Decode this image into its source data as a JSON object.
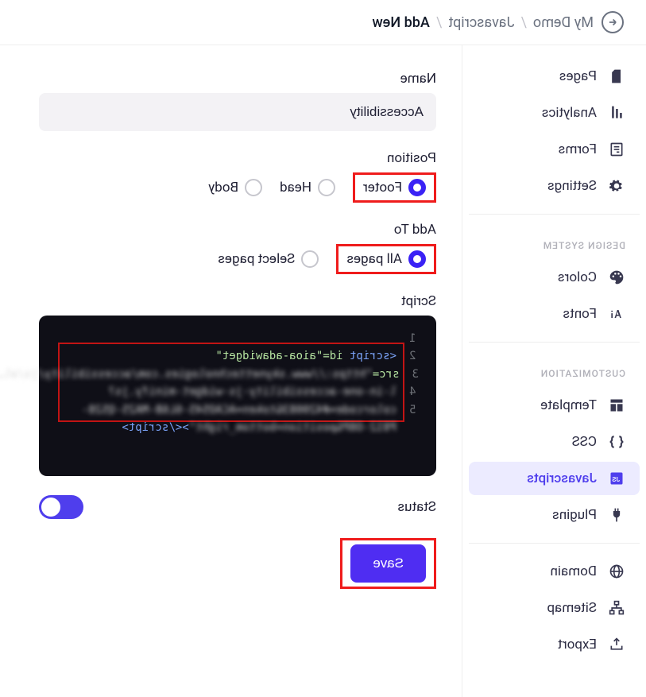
{
  "breadcrumb": {
    "level1": "My Demo",
    "level2": "Javascript",
    "current": "Add New"
  },
  "sidebar": {
    "groups": [
      {
        "title": null,
        "items": [
          {
            "key": "pages",
            "label": "Pages"
          },
          {
            "key": "analytics",
            "label": "Analytics"
          },
          {
            "key": "forms",
            "label": "Forms"
          },
          {
            "key": "settings",
            "label": "Settings"
          }
        ]
      },
      {
        "title": "DESIGN SYSTEM",
        "items": [
          {
            "key": "colors",
            "label": "Colors"
          },
          {
            "key": "fonts",
            "label": "Fonts"
          }
        ]
      },
      {
        "title": "CUSTOMIZATION",
        "items": [
          {
            "key": "template",
            "label": "Template"
          },
          {
            "key": "css",
            "label": "CSS"
          },
          {
            "key": "javascripts",
            "label": "Javascripts",
            "active": true
          },
          {
            "key": "plugins",
            "label": "Plugins"
          }
        ]
      },
      {
        "title": null,
        "items": [
          {
            "key": "domain",
            "label": "Domain"
          },
          {
            "key": "sitemap",
            "label": "Sitemap"
          },
          {
            "key": "export",
            "label": "Export"
          }
        ]
      }
    ]
  },
  "form": {
    "name_label": "Name",
    "name_value": "Accessibility",
    "position_label": "Position",
    "position_options": [
      "Footer",
      "Head",
      "Body"
    ],
    "position_selected": "Footer",
    "addto_label": "Add To",
    "addto_options": [
      "All pages",
      "Select pages"
    ],
    "addto_selected": "All pages",
    "script_label": "Script",
    "status_label": "Status",
    "status_on": true,
    "save_label": "Save"
  },
  "code": {
    "line1_open": "<script ",
    "line1_attr": "id=\"aioa-adawidget\"",
    "line2_src_prefix": "src=",
    "line2_blur": "\"https://www.skynettechnologies.com/accessibility/js/al…",
    "line3_blur": "l-in-one-accessibility-js-widget-minify.js?",
    "line4_blur": "colorcode=#420083&token=ACAO545-6L6B-MA25-Q528-",
    "line5_blur": "P812-O8P&position=bottom_right\"",
    "line5_close": "></",
    "line5_tag": "script",
    "line5_end": ">"
  }
}
